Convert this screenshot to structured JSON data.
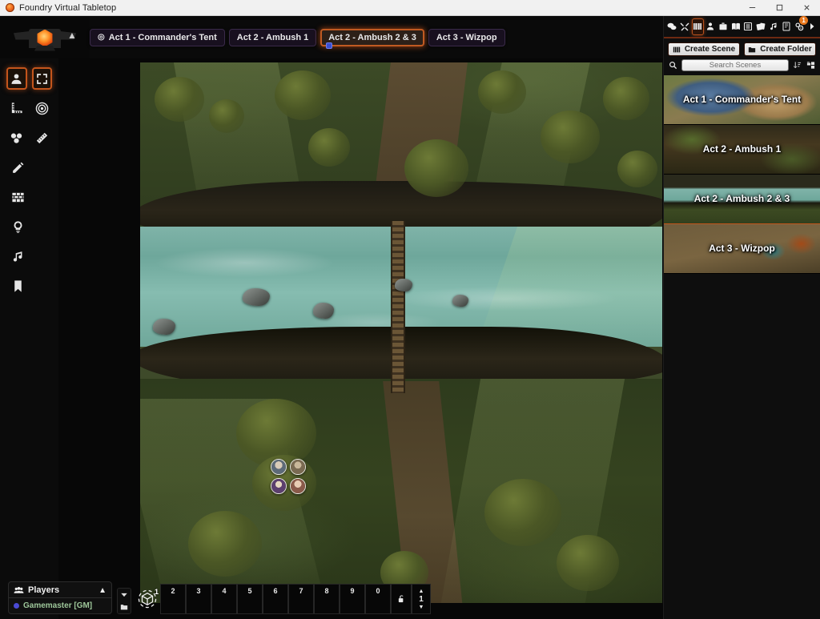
{
  "window": {
    "title": "Foundry Virtual Tabletop",
    "logo_icon": "foundry-logo-icon",
    "minimize_label": "–",
    "maximize_label": "□",
    "close_label": "✕"
  },
  "nav": {
    "logo_icon": "foundry-anvil-icon",
    "collapse_icon": "chevron-up-icon",
    "tabs": [
      {
        "label": "Act 1 - Commander's Tent",
        "icon": "target-icon",
        "active": false,
        "pin": false
      },
      {
        "label": "Act 2 - Ambush 1",
        "icon": "",
        "active": false,
        "pin": false
      },
      {
        "label": "Act 2 - Ambush 2 & 3",
        "icon": "",
        "active": true,
        "pin": true
      },
      {
        "label": "Act 3 - Wizpop",
        "icon": "",
        "active": false,
        "pin": false
      }
    ]
  },
  "tools": {
    "rows": [
      [
        {
          "name": "token-controls-tool",
          "icon": "user-icon",
          "active": true
        },
        {
          "name": "select-target-tool",
          "icon": "expand-frame-icon",
          "active": true
        }
      ],
      [
        {
          "name": "measure-template-tool",
          "icon": "ruler-square-icon",
          "active": false
        },
        {
          "name": "target-tool",
          "icon": "bullseye-icon",
          "active": false
        }
      ],
      [
        {
          "name": "tiles-tool",
          "icon": "cubes-icon",
          "active": false
        },
        {
          "name": "ruler-tool",
          "icon": "ruler-icon",
          "active": false
        }
      ],
      [
        {
          "name": "drawings-tool",
          "icon": "pencil-icon",
          "active": false
        }
      ],
      [
        {
          "name": "walls-tool",
          "icon": "brick-wall-icon",
          "active": false
        }
      ],
      [
        {
          "name": "lighting-tool",
          "icon": "lightbulb-icon",
          "active": false
        }
      ],
      [
        {
          "name": "sounds-tool",
          "icon": "music-note-icon",
          "active": false
        }
      ],
      [
        {
          "name": "notes-tool",
          "icon": "bookmark-icon",
          "active": false
        }
      ]
    ]
  },
  "sidebar": {
    "tabs": [
      {
        "name": "chat",
        "icon": "chat-bubbles-icon",
        "active": false,
        "badge": ""
      },
      {
        "name": "combat",
        "icon": "swords-icon",
        "active": false,
        "badge": ""
      },
      {
        "name": "scenes",
        "icon": "map-book-icon",
        "active": true,
        "badge": ""
      },
      {
        "name": "actors",
        "icon": "user-icon",
        "active": false,
        "badge": ""
      },
      {
        "name": "items",
        "icon": "briefcase-icon",
        "active": false,
        "badge": ""
      },
      {
        "name": "journal",
        "icon": "book-open-icon",
        "active": false,
        "badge": ""
      },
      {
        "name": "tables",
        "icon": "list-icon",
        "active": false,
        "badge": ""
      },
      {
        "name": "cards",
        "icon": "cards-icon",
        "active": false,
        "badge": ""
      },
      {
        "name": "playlists",
        "icon": "music-note-icon",
        "active": false,
        "badge": ""
      },
      {
        "name": "compendium",
        "icon": "atlas-icon",
        "active": false,
        "badge": ""
      },
      {
        "name": "settings",
        "icon": "gears-icon",
        "active": false,
        "badge": "1"
      },
      {
        "name": "collapse",
        "icon": "chevron-right-icon",
        "active": false,
        "badge": ""
      }
    ],
    "create_scene_label": "Create Scene",
    "create_scene_icon": "map-book-icon",
    "create_folder_label": "Create Folder",
    "create_folder_icon": "folder-icon",
    "search_icon": "magnifier-icon",
    "search_placeholder": "Search Scenes",
    "search_value": "",
    "sort_icon": "sort-icon",
    "folder_view_icon": "folder-tree-icon",
    "scenes": [
      {
        "name": "Act 1 - Commander's Tent",
        "thumb": "th1",
        "active": false
      },
      {
        "name": "Act 2 - Ambush 1",
        "thumb": "th2",
        "active": false
      },
      {
        "name": "Act 2 - Ambush 2 & 3",
        "thumb": "th3",
        "active": true
      },
      {
        "name": "Act 3 - Wizpop",
        "thumb": "th4",
        "active": false
      }
    ]
  },
  "players": {
    "icon": "users-icon",
    "title": "Players",
    "collapse_icon": "chevron-up-icon",
    "list": [
      {
        "name": "Gamemaster [GM]",
        "color": "#4a4ad4"
      }
    ]
  },
  "hotbar": {
    "dice_icon": "dice-target-icon",
    "dice_number": "1",
    "collapse_icon": "caret-down-icon",
    "folder_icon": "folder-icon",
    "slots": [
      "2",
      "3",
      "4",
      "5",
      "6",
      "7",
      "8",
      "9",
      "0"
    ],
    "lock_icon": "unlock-icon",
    "page_up_icon": "caret-up-icon",
    "page_number": "1",
    "page_down_icon": "caret-down-icon"
  },
  "map": {
    "scene_name": "Act 2 - Ambush 2 & 3",
    "tokens": [
      {
        "name": "token-1",
        "color": "#5d6a78"
      },
      {
        "name": "token-2",
        "color": "#7a6a52"
      },
      {
        "name": "token-3",
        "color": "#5c3f6e"
      },
      {
        "name": "token-4",
        "color": "#8a5a4a"
      }
    ]
  },
  "colors": {
    "accent": "#c4551c",
    "tab_bg": "#18101f",
    "sidebar_bg": "#0e0e0e",
    "river": "#7fb3a8",
    "grass": "#35431f"
  }
}
